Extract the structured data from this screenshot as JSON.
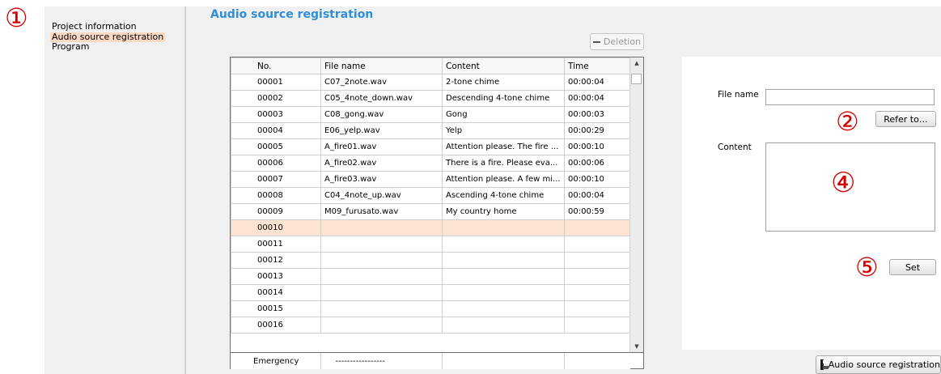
{
  "nav": {
    "items": [
      {
        "label": "Project information",
        "selected": false
      },
      {
        "label": "Audio source registration",
        "selected": true
      },
      {
        "label": "Program",
        "selected": false
      }
    ]
  },
  "page": {
    "title": "Audio source registration"
  },
  "toolbar": {
    "delete_label": "Deletion",
    "delete_icon": "minus-icon"
  },
  "table": {
    "columns": [
      "No.",
      "File name",
      "Content",
      "Time"
    ],
    "rows": [
      {
        "no": "00001",
        "file": "C07_2note.wav",
        "content": "2-tone chime",
        "time": "00:00:04"
      },
      {
        "no": "00002",
        "file": "C05_4note_down.wav",
        "content": "Descending 4-tone chime",
        "time": "00:00:04"
      },
      {
        "no": "00003",
        "file": "C08_gong.wav",
        "content": "Gong",
        "time": "00:00:03"
      },
      {
        "no": "00004",
        "file": "E06_yelp.wav",
        "content": "Yelp",
        "time": "00:00:29"
      },
      {
        "no": "00005",
        "file": "A_fire01.wav",
        "content": "Attention please. The fire ...",
        "time": "00:00:10"
      },
      {
        "no": "00006",
        "file": "A_fire02.wav",
        "content": "There is a fire. Please eva...",
        "time": "00:00:06"
      },
      {
        "no": "00007",
        "file": "A_fire03.wav",
        "content": "Attention please. A few mi...",
        "time": "00:00:10"
      },
      {
        "no": "00008",
        "file": "C04_4note_up.wav",
        "content": "Ascending 4-tone chime",
        "time": "00:00:04"
      },
      {
        "no": "00009",
        "file": "M09_furusato.wav",
        "content": "My country home",
        "time": "00:00:59"
      },
      {
        "no": "00010",
        "file": "",
        "content": "",
        "time": ""
      },
      {
        "no": "00011",
        "file": "",
        "content": "",
        "time": ""
      },
      {
        "no": "00012",
        "file": "",
        "content": "",
        "time": ""
      },
      {
        "no": "00013",
        "file": "",
        "content": "",
        "time": ""
      },
      {
        "no": "00014",
        "file": "",
        "content": "",
        "time": ""
      },
      {
        "no": "00015",
        "file": "",
        "content": "",
        "time": ""
      },
      {
        "no": "00016",
        "file": "",
        "content": "",
        "time": ""
      }
    ],
    "selected_row": "00010",
    "emergency": {
      "no": "Emergency",
      "file": "-----------------"
    }
  },
  "detail": {
    "file_name_label": "File name",
    "file_name_value": "",
    "refer_button": "Refer to…",
    "content_label": "Content",
    "content_value": "",
    "set_button": "Set"
  },
  "footer": {
    "register_button": "Audio source registration",
    "register_icon": "save-icon"
  },
  "callouts": {
    "c1": "①",
    "c2": "②",
    "c4": "④",
    "c5": "⑤"
  },
  "colors": {
    "accent_title": "#2e8fd8",
    "selection": "#fde3d2",
    "callout": "#d40000"
  }
}
